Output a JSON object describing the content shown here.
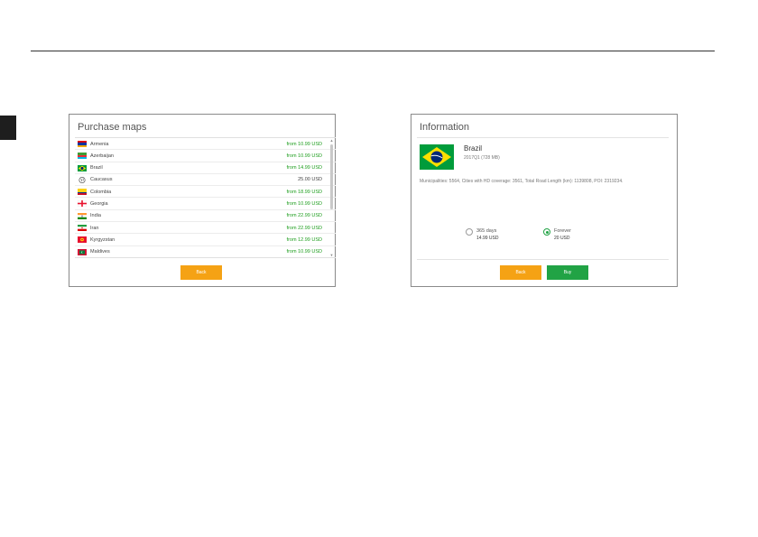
{
  "purchase": {
    "title": "Purchase maps",
    "items": [
      {
        "name": "Armenia",
        "price": "from 10.99 USD",
        "flag": "armenia-flag-icon"
      },
      {
        "name": "Azerbaijan",
        "price": "from 10.99 USD",
        "flag": "azerbaijan-flag-icon"
      },
      {
        "name": "Brazil",
        "price": "from 14.99 USD",
        "flag": "brazil-flag-icon"
      },
      {
        "name": "Caucasus",
        "price": "25.00 USD",
        "flag": "globe-icon"
      },
      {
        "name": "Colombia",
        "price": "from 18.99 USD",
        "flag": "colombia-flag-icon"
      },
      {
        "name": "Georgia",
        "price": "from 10.99 USD",
        "flag": "georgia-flag-icon"
      },
      {
        "name": "India",
        "price": "from 22.99 USD",
        "flag": "india-flag-icon"
      },
      {
        "name": "Iran",
        "price": "from 22.99 USD",
        "flag": "iran-flag-icon"
      },
      {
        "name": "Kyrgyzstan",
        "price": "from 12.99 USD",
        "flag": "kyrgyzstan-flag-icon"
      },
      {
        "name": "Maldives",
        "price": "from 10.99 USD",
        "flag": "maldives-flag-icon"
      }
    ],
    "back_label": "Back"
  },
  "information": {
    "title": "Information",
    "country": "Brazil",
    "version": "2017Q1 (728 MB)",
    "stats": "Municipalities: 5564, Cities with HD coverage: 3561, Total Road Length (km): 1139808, POI: 2319234.",
    "options": [
      {
        "label": "365 days",
        "price": "14.99 USD",
        "selected": false
      },
      {
        "label": "Forever",
        "price": "20 USD",
        "selected": true
      }
    ],
    "back_label": "Back",
    "buy_label": "Buy"
  },
  "colors": {
    "price_green": "#1e9e1e",
    "back_orange": "#f5a214",
    "buy_green": "#21a345"
  }
}
